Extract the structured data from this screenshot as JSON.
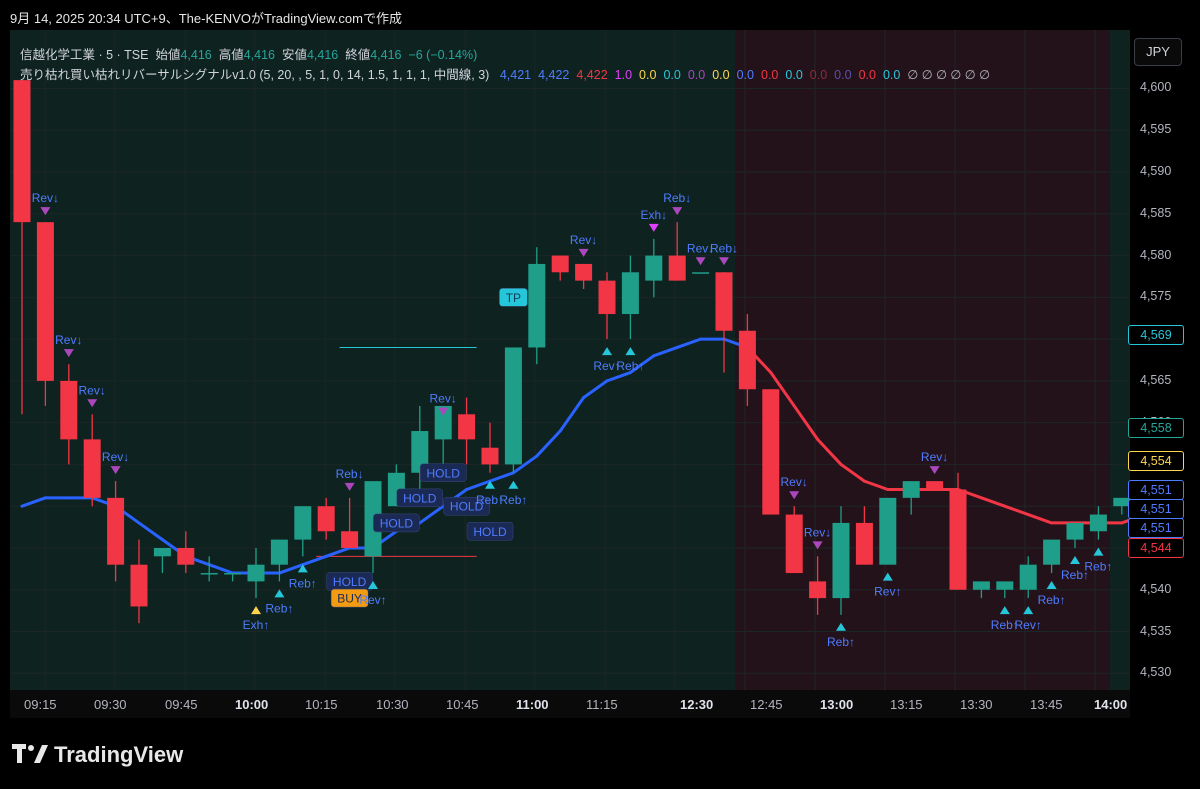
{
  "header": {
    "text": "9月 14, 2025 20:34 UTC+9、The-KENVOがTradingView.comで作成"
  },
  "legend": {
    "symbol": "信越化学工業 · 5 · TSE",
    "open_label": "始値",
    "open_value": "4,416",
    "high_label": "高値",
    "high_value": "4,416",
    "low_label": "安値",
    "low_value": "4,416",
    "close_label": "終値",
    "close_value": "4,416",
    "change": "−6 (−0.14%)",
    "indicator": "売り枯れ買い枯れリバーサルシグナルv1.0 (5, 20, , 5, 1, 0, 14, 1.5, 1, 1, 1, 中間線, 3)",
    "indicator_values": [
      {
        "text": "4,421",
        "color": "#4f7cff"
      },
      {
        "text": "4,422",
        "color": "#4f7cff"
      },
      {
        "text": "4,422",
        "color": "#f23645"
      },
      {
        "text": "1.0",
        "color": "#e040fb"
      },
      {
        "text": "0.0",
        "color": "#ffd54f"
      },
      {
        "text": "0.0",
        "color": "#26c6da"
      },
      {
        "text": "0.0",
        "color": "#ab47bc"
      },
      {
        "text": "0.0",
        "color": "#ffd54f"
      },
      {
        "text": "0.0",
        "color": "#4f7cff"
      },
      {
        "text": "0.0",
        "color": "#f23645"
      },
      {
        "text": "0.0",
        "color": "#26c6da"
      },
      {
        "text": "0.0",
        "color": "#8e2b3c"
      },
      {
        "text": "0.0",
        "color": "#5c4db1"
      },
      {
        "text": "0.0",
        "color": "#f23645"
      },
      {
        "text": "0.0",
        "color": "#26c6da"
      },
      {
        "text": "∅ ∅ ∅ ∅ ∅ ∅",
        "color": "#b2b5be"
      }
    ]
  },
  "currency_button": "JPY",
  "price_badges": [
    {
      "text": "4,569",
      "color": "#26c6da"
    },
    {
      "text": "4,558",
      "color": "#26a69a"
    },
    {
      "text": "4,554",
      "color": "#ffd54f"
    },
    {
      "text": "4,551",
      "color": "#4f7cff"
    },
    {
      "text": "4,551",
      "color": "#4f7cff"
    },
    {
      "text": "4,551",
      "color": "#4f7cff"
    },
    {
      "text": "4,544",
      "color": "#f23645"
    }
  ],
  "brand": "TradingView",
  "chart_data": {
    "type": "candlestick",
    "title": "信越化学工業 · 5 · TSE",
    "y_ticks": [
      "4,530",
      "4,535",
      "4,540",
      "4,545",
      "4,550",
      "4,555",
      "4,560",
      "4,565",
      "4,570",
      "4,575",
      "4,580",
      "4,585",
      "4,590",
      "4,595",
      "4,600"
    ],
    "x_ticks": [
      {
        "label": "09:15",
        "bold": false
      },
      {
        "label": "09:30",
        "bold": false
      },
      {
        "label": "09:45",
        "bold": false
      },
      {
        "label": "10:00",
        "bold": true
      },
      {
        "label": "10:15",
        "bold": false
      },
      {
        "label": "10:30",
        "bold": false
      },
      {
        "label": "10:45",
        "bold": false
      },
      {
        "label": "11:00",
        "bold": true
      },
      {
        "label": "11:15",
        "bold": false
      },
      {
        "label": "12:30",
        "bold": true
      },
      {
        "label": "12:45",
        "bold": false
      },
      {
        "label": "13:00",
        "bold": true
      },
      {
        "label": "13:15",
        "bold": false
      },
      {
        "label": "13:30",
        "bold": false
      },
      {
        "label": "13:45",
        "bold": false
      },
      {
        "label": "14:00",
        "bold": true
      }
    ],
    "ylim": [
      4528,
      4607
    ],
    "colors": {
      "up": "#1f9e89",
      "down": "#f23645",
      "ma_up": "#2962ff",
      "ma_down": "#f23645",
      "buy_bg": "#0e2220",
      "sell_bg": "#24121a"
    },
    "candles": [
      {
        "o": 4601,
        "h": 4601,
        "l": 4561,
        "c": 4584
      },
      {
        "o": 4584,
        "h": 4584,
        "l": 4562,
        "c": 4565
      },
      {
        "o": 4565,
        "h": 4567,
        "l": 4555,
        "c": 4558
      },
      {
        "o": 4558,
        "h": 4561,
        "l": 4550,
        "c": 4551
      },
      {
        "o": 4551,
        "h": 4553,
        "l": 4541,
        "c": 4543
      },
      {
        "o": 4543,
        "h": 4546,
        "l": 4536,
        "c": 4538
      },
      {
        "o": 4544,
        "h": 4545,
        "l": 4542,
        "c": 4545
      },
      {
        "o": 4545,
        "h": 4547,
        "l": 4542,
        "c": 4543
      },
      {
        "o": 4542,
        "h": 4544,
        "l": 4541,
        "c": 4542
      },
      {
        "o": 4542,
        "h": 4542,
        "l": 4541,
        "c": 4542
      },
      {
        "o": 4541,
        "h": 4545,
        "l": 4539,
        "c": 4543
      },
      {
        "o": 4543,
        "h": 4546,
        "l": 4541,
        "c": 4546
      },
      {
        "o": 4546,
        "h": 4550,
        "l": 4544,
        "c": 4550
      },
      {
        "o": 4550,
        "h": 4551,
        "l": 4546,
        "c": 4547
      },
      {
        "o": 4547,
        "h": 4551,
        "l": 4545,
        "c": 4545
      },
      {
        "o": 4544,
        "h": 4551,
        "l": 4542,
        "c": 4553
      },
      {
        "o": 4550,
        "h": 4555,
        "l": 4550,
        "c": 4554
      },
      {
        "o": 4554,
        "h": 4562,
        "l": 4550,
        "c": 4559
      },
      {
        "o": 4558,
        "h": 4560,
        "l": 4555,
        "c": 4562
      },
      {
        "o": 4561,
        "h": 4563,
        "l": 4555,
        "c": 4558
      },
      {
        "o": 4557,
        "h": 4560,
        "l": 4554,
        "c": 4555
      },
      {
        "o": 4555,
        "h": 4569,
        "l": 4554,
        "c": 4569
      },
      {
        "o": 4569,
        "h": 4581,
        "l": 4567,
        "c": 4579
      },
      {
        "o": 4580,
        "h": 4580,
        "l": 4577,
        "c": 4578
      },
      {
        "o": 4579,
        "h": 4579,
        "l": 4576,
        "c": 4577
      },
      {
        "o": 4577,
        "h": 4578,
        "l": 4570,
        "c": 4573
      },
      {
        "o": 4573,
        "h": 4580,
        "l": 4570,
        "c": 4578
      },
      {
        "o": 4577,
        "h": 4582,
        "l": 4575,
        "c": 4580
      },
      {
        "o": 4580,
        "h": 4584,
        "l": 4577,
        "c": 4577
      },
      {
        "o": 4578,
        "h": 4578,
        "l": 4578,
        "c": 4578
      },
      {
        "o": 4578,
        "h": 4578,
        "l": 4566,
        "c": 4571
      },
      {
        "o": 4571,
        "h": 4573,
        "l": 4562,
        "c": 4564
      },
      {
        "o": 4564,
        "h": 4564,
        "l": 4549,
        "c": 4549
      },
      {
        "o": 4549,
        "h": 4550,
        "l": 4542,
        "c": 4542
      },
      {
        "o": 4541,
        "h": 4544,
        "l": 4537,
        "c": 4539
      },
      {
        "o": 4539,
        "h": 4550,
        "l": 4537,
        "c": 4548
      },
      {
        "o": 4548,
        "h": 4550,
        "l": 4543,
        "c": 4543
      },
      {
        "o": 4543,
        "h": 4551,
        "l": 4543,
        "c": 4551
      },
      {
        "o": 4551,
        "h": 4553,
        "l": 4549,
        "c": 4553
      },
      {
        "o": 4553,
        "h": 4553,
        "l": 4552,
        "c": 4552
      },
      {
        "o": 4552,
        "h": 4554,
        "l": 4540,
        "c": 4540
      },
      {
        "o": 4540,
        "h": 4541,
        "l": 4539,
        "c": 4541
      },
      {
        "o": 4540,
        "h": 4541,
        "l": 4539,
        "c": 4541
      },
      {
        "o": 4540,
        "h": 4544,
        "l": 4539,
        "c": 4543
      },
      {
        "o": 4543,
        "h": 4546,
        "l": 4542,
        "c": 4546
      },
      {
        "o": 4546,
        "h": 4548,
        "l": 4545,
        "c": 4548
      },
      {
        "o": 4547,
        "h": 4550,
        "l": 4546,
        "c": 4549
      },
      {
        "o": 4550,
        "h": 4551,
        "l": 4549,
        "c": 4551
      },
      {
        "o": 4549,
        "h": 4551,
        "l": 4548,
        "c": 4549
      },
      {
        "o": 4551,
        "h": 4558,
        "l": 4550,
        "c": 4558
      }
    ],
    "ma": [
      4550,
      4551,
      4551,
      4551,
      4550,
      4548,
      4546,
      4544,
      4543,
      4542,
      4542,
      4542,
      4543,
      4544,
      4545,
      4545,
      4547,
      4548,
      4550,
      4552,
      4553,
      4554,
      4556,
      4559,
      4563,
      4565,
      4566,
      4568,
      4569,
      4570,
      4570,
      4569,
      4566,
      4562,
      4558,
      4555,
      4553,
      4552,
      4552,
      4552,
      4552,
      4551,
      4550,
      4549,
      4548,
      4548,
      4548,
      4548,
      4549,
      4550
    ],
    "session_split_index": 31,
    "signals": [
      {
        "i": 1,
        "type": "down",
        "label": "Rev↓",
        "color": "#ab47bc",
        "text_color": "#4f7cff"
      },
      {
        "i": 2,
        "type": "down",
        "label": "Rev↓",
        "color": "#ab47bc",
        "text_color": "#4f7cff"
      },
      {
        "i": 3,
        "type": "down",
        "label": "Rev↓",
        "color": "#ab47bc",
        "text_color": "#4f7cff"
      },
      {
        "i": 4,
        "type": "down",
        "label": "Rev↓",
        "color": "#ab47bc",
        "text_color": "#4f7cff"
      },
      {
        "i": 10,
        "type": "up",
        "label": "Exh↑",
        "color": "#ffd54f",
        "text_color": "#4f7cff"
      },
      {
        "i": 11,
        "type": "up",
        "label": "Reb↑",
        "color": "#26c6da",
        "text_color": "#4f7cff"
      },
      {
        "i": 12,
        "type": "up",
        "label": "Reb↑",
        "color": "#26c6da",
        "text_color": "#4f7cff"
      },
      {
        "i": 14,
        "type": "down",
        "label": "Reb↓",
        "color": "#ab47bc",
        "text_color": "#4f7cff"
      },
      {
        "i": 15,
        "type": "up",
        "label": "Rev↑",
        "color": "#26c6da",
        "text_color": "#4f7cff"
      },
      {
        "i": 18,
        "type": "down",
        "label": "Rev↓",
        "color": "#ab47bc",
        "text_color": "#4f7cff"
      },
      {
        "i": 20,
        "type": "up",
        "label": "Reb↑",
        "color": "#26c6da",
        "text_color": "#4f7cff"
      },
      {
        "i": 21,
        "type": "up",
        "label": "Reb↑",
        "color": "#26c6da",
        "text_color": "#4f7cff"
      },
      {
        "i": 24,
        "type": "down",
        "label": "Rev↓",
        "color": "#ab47bc",
        "text_color": "#4f7cff"
      },
      {
        "i": 25,
        "type": "up",
        "label": "Rev↑",
        "color": "#26c6da",
        "text_color": "#4f7cff"
      },
      {
        "i": 26,
        "type": "up",
        "label": "Reb↑",
        "color": "#26c6da",
        "text_color": "#4f7cff"
      },
      {
        "i": 27,
        "type": "down",
        "label": "Exh↓",
        "color": "#e040fb",
        "text_color": "#4f7cff"
      },
      {
        "i": 28,
        "type": "down",
        "label": "Reb↓",
        "color": "#ab47bc",
        "text_color": "#4f7cff"
      },
      {
        "i": 29,
        "type": "down",
        "label": "Rev↓",
        "color": "#ab47bc",
        "text_color": "#4f7cff"
      },
      {
        "i": 30,
        "type": "down",
        "label": "Reb↓",
        "color": "#ab47bc",
        "text_color": "#4f7cff"
      },
      {
        "i": 33,
        "type": "down",
        "label": "Rev↓",
        "color": "#ab47bc",
        "text_color": "#4f7cff"
      },
      {
        "i": 34,
        "type": "down",
        "label": "Rev↓",
        "color": "#ab47bc",
        "text_color": "#4f7cff"
      },
      {
        "i": 35,
        "type": "up",
        "label": "Reb↑",
        "color": "#26c6da",
        "text_color": "#4f7cff"
      },
      {
        "i": 37,
        "type": "up",
        "label": "Rev↑",
        "color": "#26c6da",
        "text_color": "#4f7cff"
      },
      {
        "i": 39,
        "type": "down",
        "label": "Rev↓",
        "color": "#ab47bc",
        "text_color": "#4f7cff"
      },
      {
        "i": 42,
        "type": "up",
        "label": "Reb↑",
        "color": "#26c6da",
        "text_color": "#4f7cff"
      },
      {
        "i": 43,
        "type": "up",
        "label": "Rev↑",
        "color": "#26c6da",
        "text_color": "#4f7cff"
      },
      {
        "i": 44,
        "type": "up",
        "label": "Reb↑",
        "color": "#26c6da",
        "text_color": "#4f7cff"
      },
      {
        "i": 45,
        "type": "up",
        "label": "Reb↑",
        "color": "#26c6da",
        "text_color": "#4f7cff"
      },
      {
        "i": 46,
        "type": "up",
        "label": "Reb↑",
        "color": "#26c6da",
        "text_color": "#4f7cff"
      }
    ],
    "boxes": [
      {
        "i": 14,
        "price": 4541,
        "label": "HOLD",
        "fill": "#1b2a55",
        "text_color": "#4f7cff"
      },
      {
        "i": 14,
        "price": 4539,
        "label": "BUY",
        "fill": "#f39c12",
        "text_color": "#1b2a55"
      },
      {
        "i": 16,
        "price": 4548,
        "label": "HOLD",
        "fill": "#1b2a55",
        "text_color": "#4f7cff"
      },
      {
        "i": 17,
        "price": 4551,
        "label": "HOLD",
        "fill": "#1b2a55",
        "text_color": "#4f7cff"
      },
      {
        "i": 18,
        "price": 4554,
        "label": "HOLD",
        "fill": "#1b2a55",
        "text_color": "#4f7cff"
      },
      {
        "i": 19,
        "price": 4550,
        "label": "HOLD",
        "fill": "#1b2a55",
        "text_color": "#4f7cff"
      },
      {
        "i": 20,
        "price": 4547,
        "label": "HOLD",
        "fill": "#1b2a55",
        "text_color": "#4f7cff"
      },
      {
        "i": 21,
        "price": 4575,
        "label": "TP",
        "fill": "#26c6da",
        "text_color": "#0a3a5a"
      }
    ],
    "levels": [
      {
        "from": 14,
        "to": 19,
        "price": 4569,
        "color": "#26c6da"
      },
      {
        "from": 13,
        "to": 19,
        "price": 4544,
        "color": "#f23645"
      }
    ]
  }
}
